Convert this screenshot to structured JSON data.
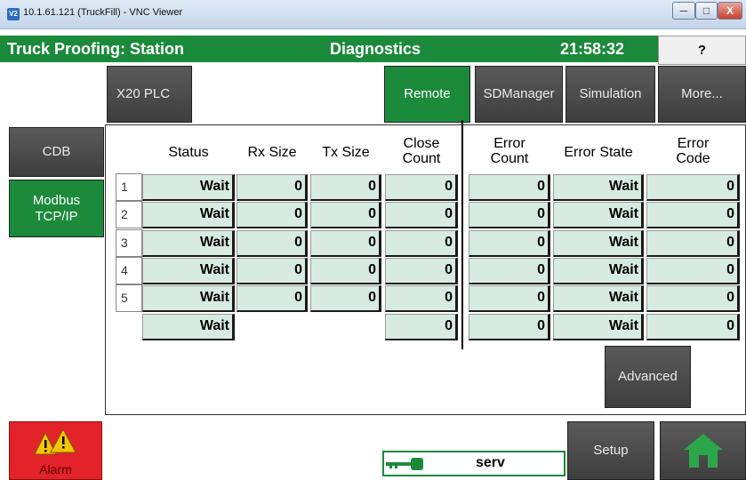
{
  "vnc": {
    "title": "10.1.61.121 (TruckFill) - VNC Viewer",
    "logo": "V2",
    "min": "─",
    "max": "□",
    "close": "X"
  },
  "header": {
    "title": "Truck Proofing: Station",
    "screen": "Diagnostics",
    "time": "21:58:32",
    "help": "?"
  },
  "top_tabs": {
    "x20": "X20 PLC",
    "remote": "Remote",
    "sdmanager": "SDManager",
    "simulation": "Simulation",
    "more": "More..."
  },
  "side_tabs": {
    "cdb": "CDB",
    "modbus": "Modbus\nTCP/IP"
  },
  "table": {
    "headers": {
      "status": "Status",
      "rx": "Rx Size",
      "tx": "Tx Size",
      "close": "Close\nCount",
      "err_count": "Error\nCount",
      "err_state": "Error State",
      "err_code": "Error\nCode"
    },
    "rows": [
      {
        "n": "1",
        "status": "Wait",
        "rx": "0",
        "tx": "0",
        "close": "0",
        "err_count": "0",
        "err_state": "Wait",
        "err_code": "0"
      },
      {
        "n": "2",
        "status": "Wait",
        "rx": "0",
        "tx": "0",
        "close": "0",
        "err_count": "0",
        "err_state": "Wait",
        "err_code": "0"
      },
      {
        "n": "3",
        "status": "Wait",
        "rx": "0",
        "tx": "0",
        "close": "0",
        "err_count": "0",
        "err_state": "Wait",
        "err_code": "0"
      },
      {
        "n": "4",
        "status": "Wait",
        "rx": "0",
        "tx": "0",
        "close": "0",
        "err_count": "0",
        "err_state": "Wait",
        "err_code": "0"
      },
      {
        "n": "5",
        "status": "Wait",
        "rx": "0",
        "tx": "0",
        "close": "0",
        "err_count": "0",
        "err_state": "Wait",
        "err_code": "0"
      }
    ],
    "total": {
      "status": "Wait",
      "close": "0",
      "err_count": "0",
      "err_state": "Wait",
      "err_code": "0"
    }
  },
  "buttons": {
    "advanced": "Advanced",
    "setup": "Setup",
    "alarm": "Alarm"
  },
  "status_bar": {
    "user": "serv"
  },
  "colors": {
    "header_green": "#1b8a3a",
    "cell_fill": "#d8ebe3",
    "alarm_red": "#e3222a",
    "alarm_yellow": "#f5c400"
  },
  "icons": {
    "help": "question-icon",
    "alarm": "warning-triangles-icon",
    "home": "home-icon",
    "key": "key-icon"
  }
}
